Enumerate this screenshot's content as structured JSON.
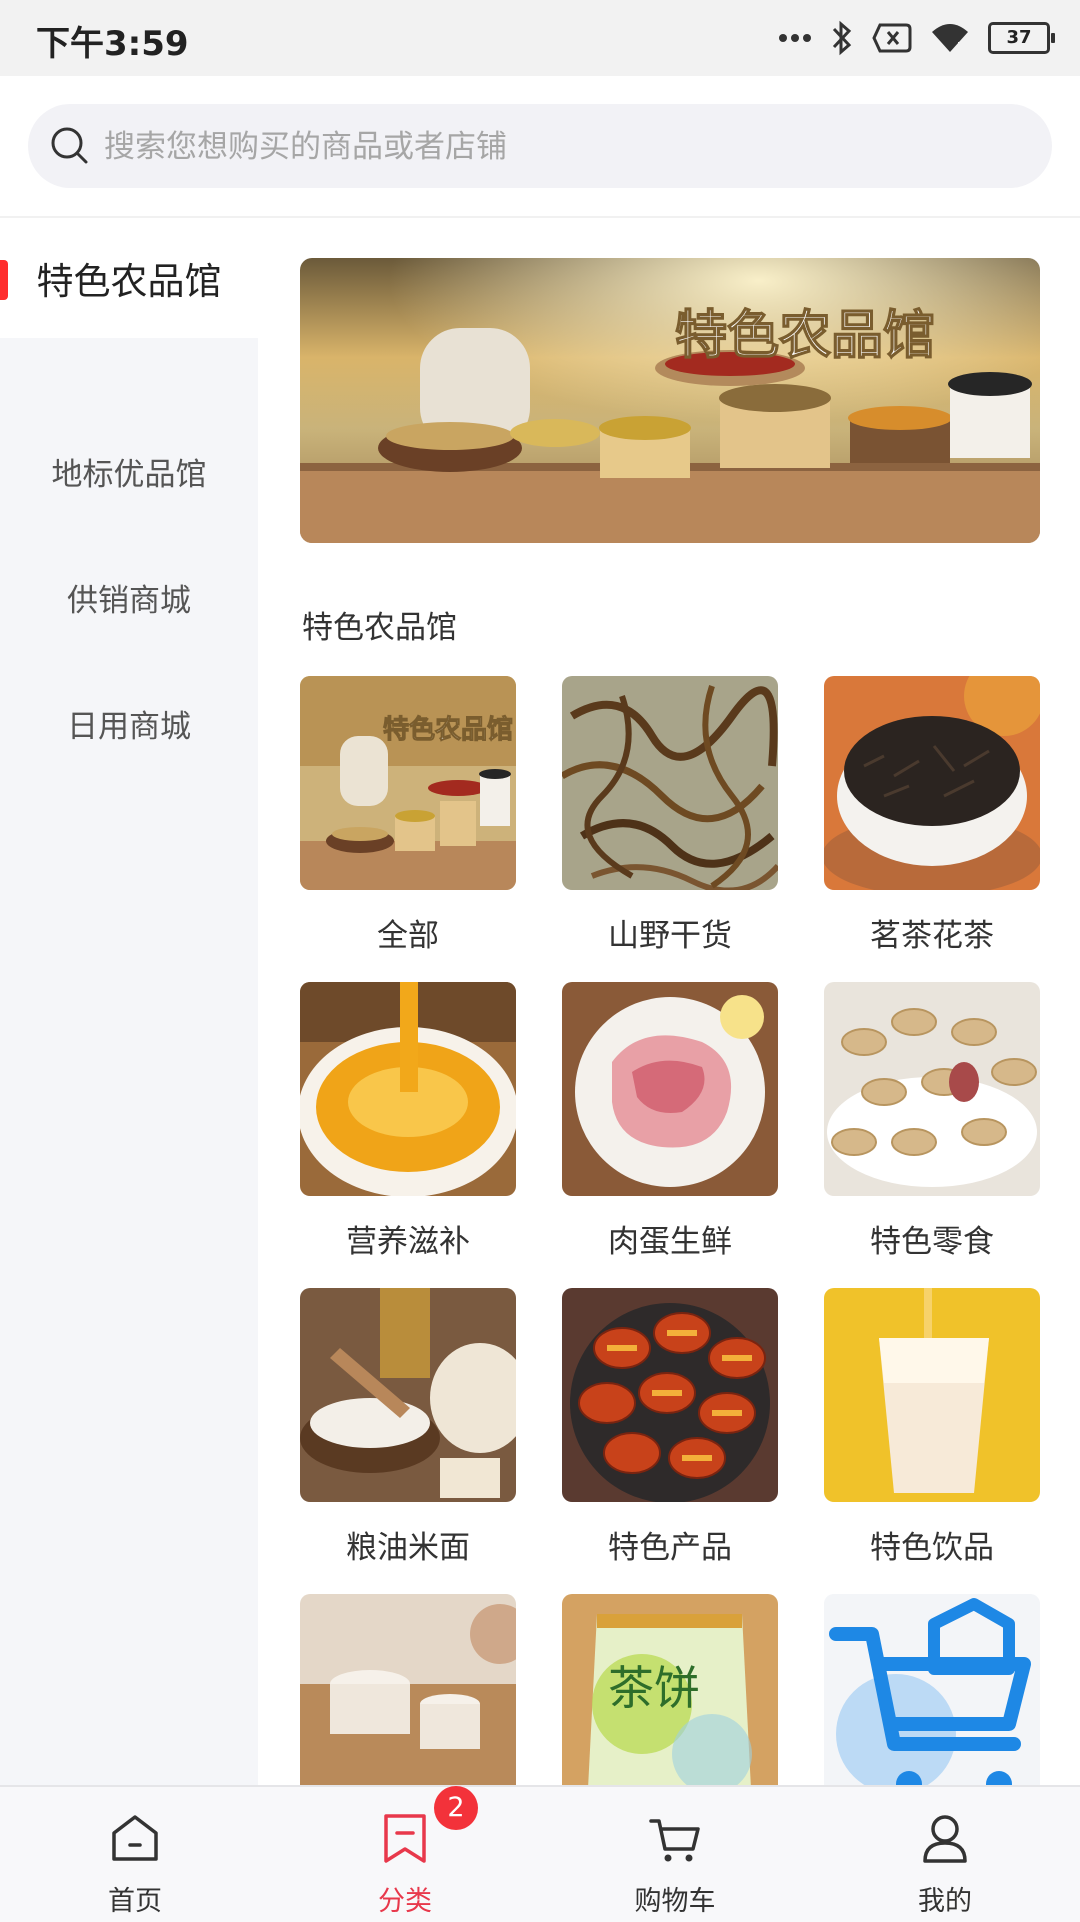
{
  "status_bar": {
    "time": "下午3:59",
    "battery": "37",
    "icons": [
      "more-dots-icon",
      "bluetooth-icon",
      "sim-off-icon",
      "wifi-icon",
      "battery-icon"
    ]
  },
  "search": {
    "placeholder": "搜索您想购买的商品或者店铺",
    "value": ""
  },
  "sidebar": {
    "items": [
      {
        "label": "特色农品馆",
        "active": true
      },
      {
        "label": "地标优品馆",
        "active": false
      },
      {
        "label": "供销商城",
        "active": false
      },
      {
        "label": "日用商城",
        "active": false
      }
    ],
    "active_color": "#ff2d2d"
  },
  "main": {
    "banner": {
      "text": "特色农品馆"
    },
    "section_title": "特色农品馆",
    "categories": [
      {
        "label": "全部",
        "image_text": "特色农品馆"
      },
      {
        "label": "山野干货"
      },
      {
        "label": "茗茶花茶"
      },
      {
        "label": "营养滋补"
      },
      {
        "label": "肉蛋生鲜"
      },
      {
        "label": "特色零食"
      },
      {
        "label": "粮油米面"
      },
      {
        "label": "特色产品"
      },
      {
        "label": "特色饮品"
      },
      {
        "label": "",
        "image_text": ""
      },
      {
        "label": "",
        "image_text": "茶饼"
      },
      {
        "label": "",
        "icon": "shopping-cart-icon"
      }
    ]
  },
  "tabbar": {
    "tabs": [
      {
        "label": "首页",
        "icon": "home-icon",
        "active": false
      },
      {
        "label": "分类",
        "icon": "category-bookmark-icon",
        "active": true
      },
      {
        "label": "购物车",
        "icon": "cart-icon",
        "active": false
      },
      {
        "label": "我的",
        "icon": "user-icon",
        "active": false
      }
    ],
    "cart_badge": "2",
    "active_color": "#e8384b"
  }
}
